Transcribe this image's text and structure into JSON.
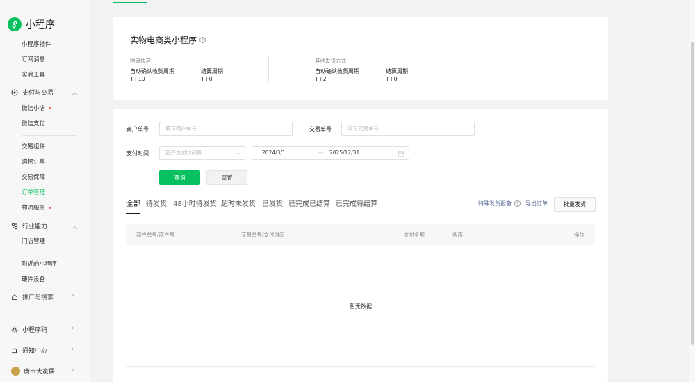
{
  "app": {
    "title": "小程序"
  },
  "sidebar": {
    "items_top": [
      "小程序插件",
      "订阅消息",
      "实验工具"
    ],
    "group_pay": "支付与交易",
    "pay_items": [
      "微信小店",
      "微信支付"
    ],
    "trade_items": [
      "交易组件",
      "购物订单",
      "交易保障",
      "订单管理",
      "物流服务"
    ],
    "group_industry": "行业能力",
    "industry_items": [
      "门店管理"
    ],
    "misc_items": [
      "附近的小程序",
      "硬件设备"
    ],
    "group_promo": "推广与搜索",
    "bottom": {
      "code": "小程序码",
      "notify": "通知中心",
      "account": "唐卡大家居"
    }
  },
  "summary": {
    "title": "实物电商类小程序",
    "logistics": {
      "label": "物流快递",
      "confirm_label": "自动确认收货周期",
      "confirm_value": "T+10",
      "settle_label": "结算周期",
      "settle_value": "T+0"
    },
    "other": {
      "label": "其他发货方式",
      "confirm_label": "自动确认收货周期",
      "confirm_value": "T+2",
      "settle_label": "结算周期",
      "settle_value": "T+0"
    }
  },
  "filters": {
    "merchant_label": "商户单号",
    "merchant_placeholder": "填写商户单号",
    "trade_label": "交易单号",
    "trade_placeholder": "填写交易单号",
    "paytime_label": "支付时间",
    "paytime_placeholder": "选择支付时间段",
    "date_start": "2024/3/1",
    "date_sep": "—",
    "date_end": "2025/12/31",
    "search_btn": "查询",
    "reset_btn": "重置"
  },
  "tabs": [
    "全部",
    "待发货",
    "48小时待发货",
    "超时未发货",
    "已发货",
    "已完成已结算",
    "已完成待结算"
  ],
  "actions": {
    "special": "特殊发货报备",
    "export": "导出订单",
    "batch": "批量发货"
  },
  "table": {
    "headers": [
      "商户单号/商户号",
      "交易单号/支付时间",
      "支付金额",
      "状态",
      "操作"
    ],
    "empty_text": "暂无数据"
  },
  "colors": {
    "accent": "#07c160",
    "link": "#576b95",
    "badge": "#fa5151"
  }
}
